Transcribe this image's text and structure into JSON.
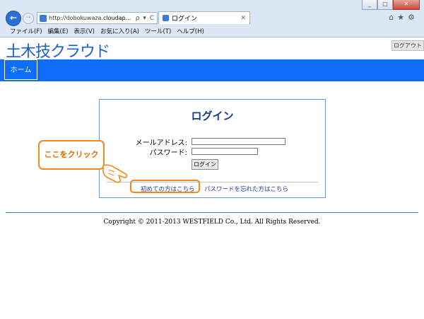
{
  "browser": {
    "address_url": "http://dobokuwaza.",
    "address_url_bold": "cloudap...",
    "address_tools": "ρ ▾ C",
    "tab_title": "ログイン",
    "window_controls": [
      "_",
      "□",
      "✕"
    ],
    "icons": [
      "home-icon",
      "star-icon",
      "gear-icon"
    ],
    "menu": [
      "ファイル(F)",
      "編集(E)",
      "表示(V)",
      "お気に入り(A)",
      "ツール(T)",
      "ヘルプ(H)"
    ]
  },
  "site": {
    "logo": "土木技クラウド",
    "logout_label": "ログアウト",
    "nav_home": "ホーム"
  },
  "login": {
    "title": "ログイン",
    "email_label": "メールアドレス:",
    "password_label": "パスワード:",
    "email_value": "",
    "password_value": "",
    "submit_label": "ログイン",
    "first_time_link": "初めての方はこちら",
    "forgot_link": "パスワードを忘れた方はこちら"
  },
  "annotation": {
    "callout_text": "ここをクリック",
    "accent_color": "#f08a1c"
  },
  "footer": {
    "copyright": "Copyright © 2011-2013 WESTFIELD Co., Ltd. All Rights Reserved."
  }
}
